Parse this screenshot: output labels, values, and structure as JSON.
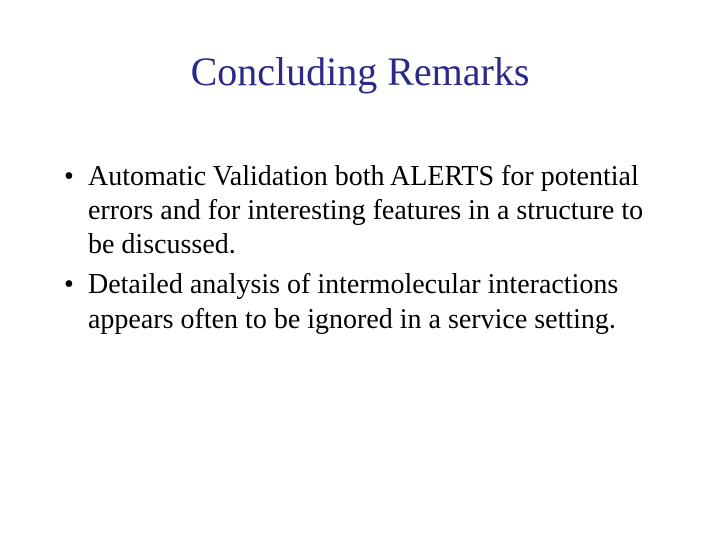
{
  "title": "Concluding Remarks",
  "bullets": [
    "Automatic Validation both ALERTS for potential errors and for interesting features in a structure to be discussed.",
    "Detailed analysis of intermolecular interactions appears often to be ignored in a service setting."
  ]
}
